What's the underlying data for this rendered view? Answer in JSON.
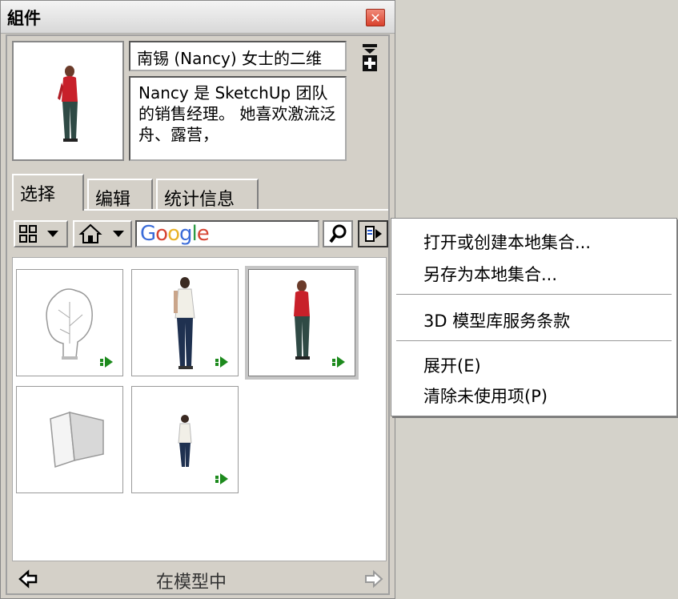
{
  "window": {
    "title": "組件",
    "close_glyph": "✕"
  },
  "component": {
    "name": "南锡 (Nancy) 女士的二维",
    "description": "Nancy 是 SketchUp 团队的销售经理。 她喜欢激流泛舟、露营，"
  },
  "tabs": [
    {
      "label": "选择",
      "active": true
    },
    {
      "label": "编辑",
      "active": false
    },
    {
      "label": "统计信息",
      "active": false
    }
  ],
  "toolbar": {
    "view_icon": "grid-view-icon",
    "home_icon": "home-icon",
    "search_placeholder": "Google",
    "search_icon": "magnifier-icon",
    "details_icon": "details-arrow-icon"
  },
  "models": [
    {
      "name": "tree",
      "icon": "tree-sketch",
      "selected": false,
      "downloadable": true
    },
    {
      "name": "man",
      "icon": "man-figure",
      "selected": false,
      "downloadable": true
    },
    {
      "name": "nancy",
      "icon": "woman-red-figure",
      "selected": true,
      "downloadable": true
    },
    {
      "name": "box",
      "icon": "3d-box",
      "selected": false,
      "downloadable": false
    },
    {
      "name": "person-small",
      "icon": "small-figure",
      "selected": false,
      "downloadable": true
    }
  ],
  "footer": {
    "label": "在模型中",
    "back_icon": "back-arrow-icon",
    "forward_icon": "forward-arrow-icon"
  },
  "menu": {
    "items": [
      "打开或创建本地集合...",
      "另存为本地集合...",
      "3D 模型库服务条款",
      "展开(E)",
      "清除未使用项(P)"
    ]
  },
  "colors": {
    "accent": "#cc2a1e",
    "download_green": "#1d8a1d"
  }
}
